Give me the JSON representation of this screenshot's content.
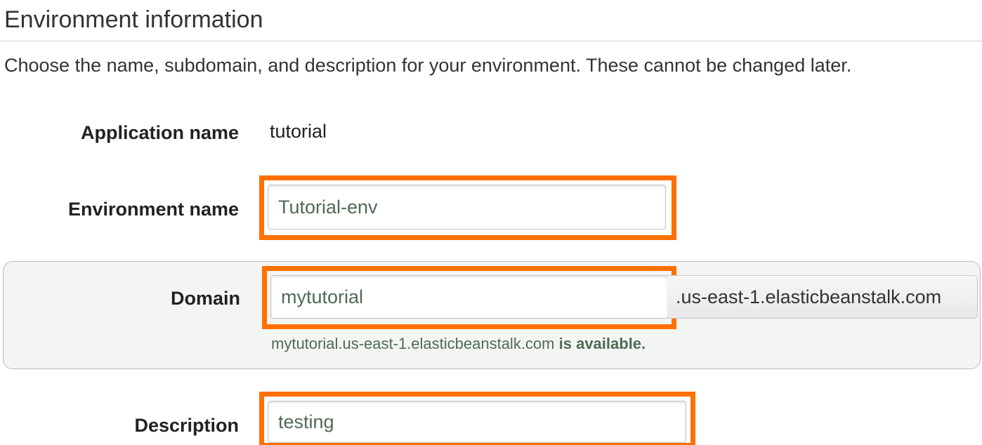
{
  "section": {
    "title": "Environment information",
    "description": "Choose the name, subdomain, and description for your environment. These cannot be changed later."
  },
  "fields": {
    "application_name": {
      "label": "Application name",
      "value": "tutorial"
    },
    "environment_name": {
      "label": "Environment name",
      "value": "Tutorial-env"
    },
    "domain": {
      "label": "Domain",
      "value": "mytutorial",
      "suffix": ".us-east-1.elasticbeanstalk.com",
      "availability_domain": "mytutorial.us-east-1.elasticbeanstalk.com",
      "availability_status": "is available."
    },
    "description": {
      "label": "Description",
      "value": "testing"
    }
  },
  "colors": {
    "highlight": "#ff7000",
    "input_text": "#4f6b55",
    "panel_background": "#f3f5f3"
  }
}
